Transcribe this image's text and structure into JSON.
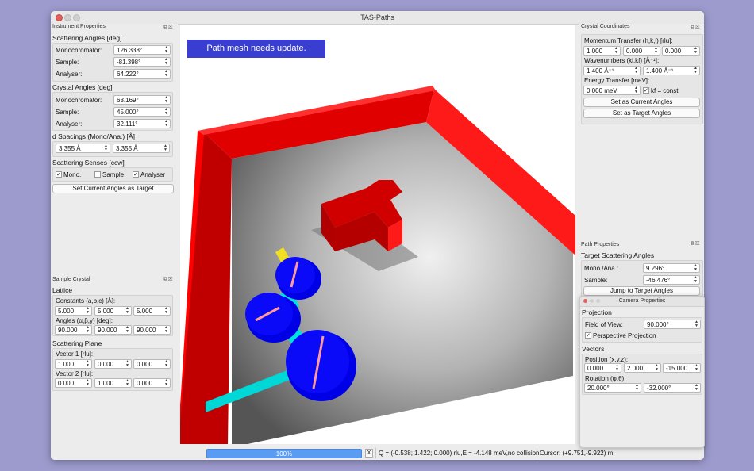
{
  "window": {
    "title": "TAS-Paths"
  },
  "instrument": {
    "title": "Instrument Properties",
    "scattering_angles": {
      "label": "Scattering Angles [deg]",
      "rows": [
        {
          "label": "Monochromator:",
          "value": "126.338°"
        },
        {
          "label": "Sample:",
          "value": "-81.398°"
        },
        {
          "label": "Analyser:",
          "value": "64.222°"
        }
      ]
    },
    "crystal_angles": {
      "label": "Crystal Angles [deg]",
      "rows": [
        {
          "label": "Monochromator:",
          "value": "63.169°"
        },
        {
          "label": "Sample:",
          "value": "45.000°"
        },
        {
          "label": "Analyser:",
          "value": "32.111°"
        }
      ]
    },
    "d_spacings": {
      "label": "d Spacings (Mono/Ana.) [Å]",
      "mono": "3.355 Å",
      "ana": "3.355 Å"
    },
    "senses": {
      "label": "Scattering Senses [ccw]",
      "mono": "Mono.",
      "sample": "Sample",
      "analyser": "Analyser"
    },
    "set_target_button": "Set Current Angles as Target"
  },
  "sample_crystal": {
    "title": "Sample Crystal",
    "lattice_label": "Lattice",
    "constants_label": "Constants (a,b,c) [Å]:",
    "constants": [
      "5.000",
      "5.000",
      "5.000"
    ],
    "angles_label": "Angles (α,β,γ) [deg]:",
    "angles": [
      "90.000",
      "90.000",
      "90.000"
    ],
    "plane_label": "Scattering Plane",
    "vector1_label": "Vector 1 [rlu]:",
    "vector1": [
      "1.000",
      "0.000",
      "0.000"
    ],
    "vector2_label": "Vector 2 [rlu]:",
    "vector2": [
      "0.000",
      "1.000",
      "0.000"
    ]
  },
  "scene": {
    "notice": "Path mesh needs update."
  },
  "crystal_coords": {
    "title": "Crystal Coordinates",
    "q_label": "Momentum Transfer (h,k,l) [rlu]:",
    "q": [
      "1.000",
      "0.000",
      "0.000"
    ],
    "k_label": "Wavenumbers (ki,kf) [Å⁻¹]:",
    "k": [
      "1.400 Å⁻¹",
      "1.400 Å⁻¹"
    ],
    "e_label": "Energy Transfer [meV]:",
    "e": "0.000 meV",
    "kf_const": "kf = const.",
    "set_current_button": "Set as Current Angles",
    "set_target_button": "Set as Target Angles"
  },
  "path_props": {
    "title": "Path Properties",
    "target_label": "Target Scattering Angles",
    "mono_label": "Mono./Ana.:",
    "mono_value": "9.296°",
    "sample_label": "Sample:",
    "sample_value": "-46.476°",
    "jump_button": "Jump to Target Angles"
  },
  "camera": {
    "title": "Camera Properties",
    "projection_label": "Projection",
    "fov_label": "Field of View:",
    "fov_value": "90.000°",
    "perspective_label": "Perspective Projection",
    "vectors_label": "Vectors",
    "position_label": "Position (x,y,z):",
    "position": [
      "0.000",
      "2.000",
      "-15.000"
    ],
    "rotation_label": "Rotation (φ,θ):",
    "rotation": [
      "20.000°",
      "-32.000°"
    ]
  },
  "status": {
    "progress_text": "100%",
    "progress": 1.0,
    "cancel": "X",
    "message": "Q = (-0.538; 1.422; 0.000) rlu,E = -4.148 meV,no collision.",
    "cursor": "Cursor: (+9.751,-9.922) m."
  },
  "colors": {
    "wall": "#ff0000",
    "floor": "#b4b4b4",
    "axis": "#00e5e5",
    "disk": "#0000e6",
    "notice": "#3a3ed0",
    "progress": "#5a9cf2"
  }
}
